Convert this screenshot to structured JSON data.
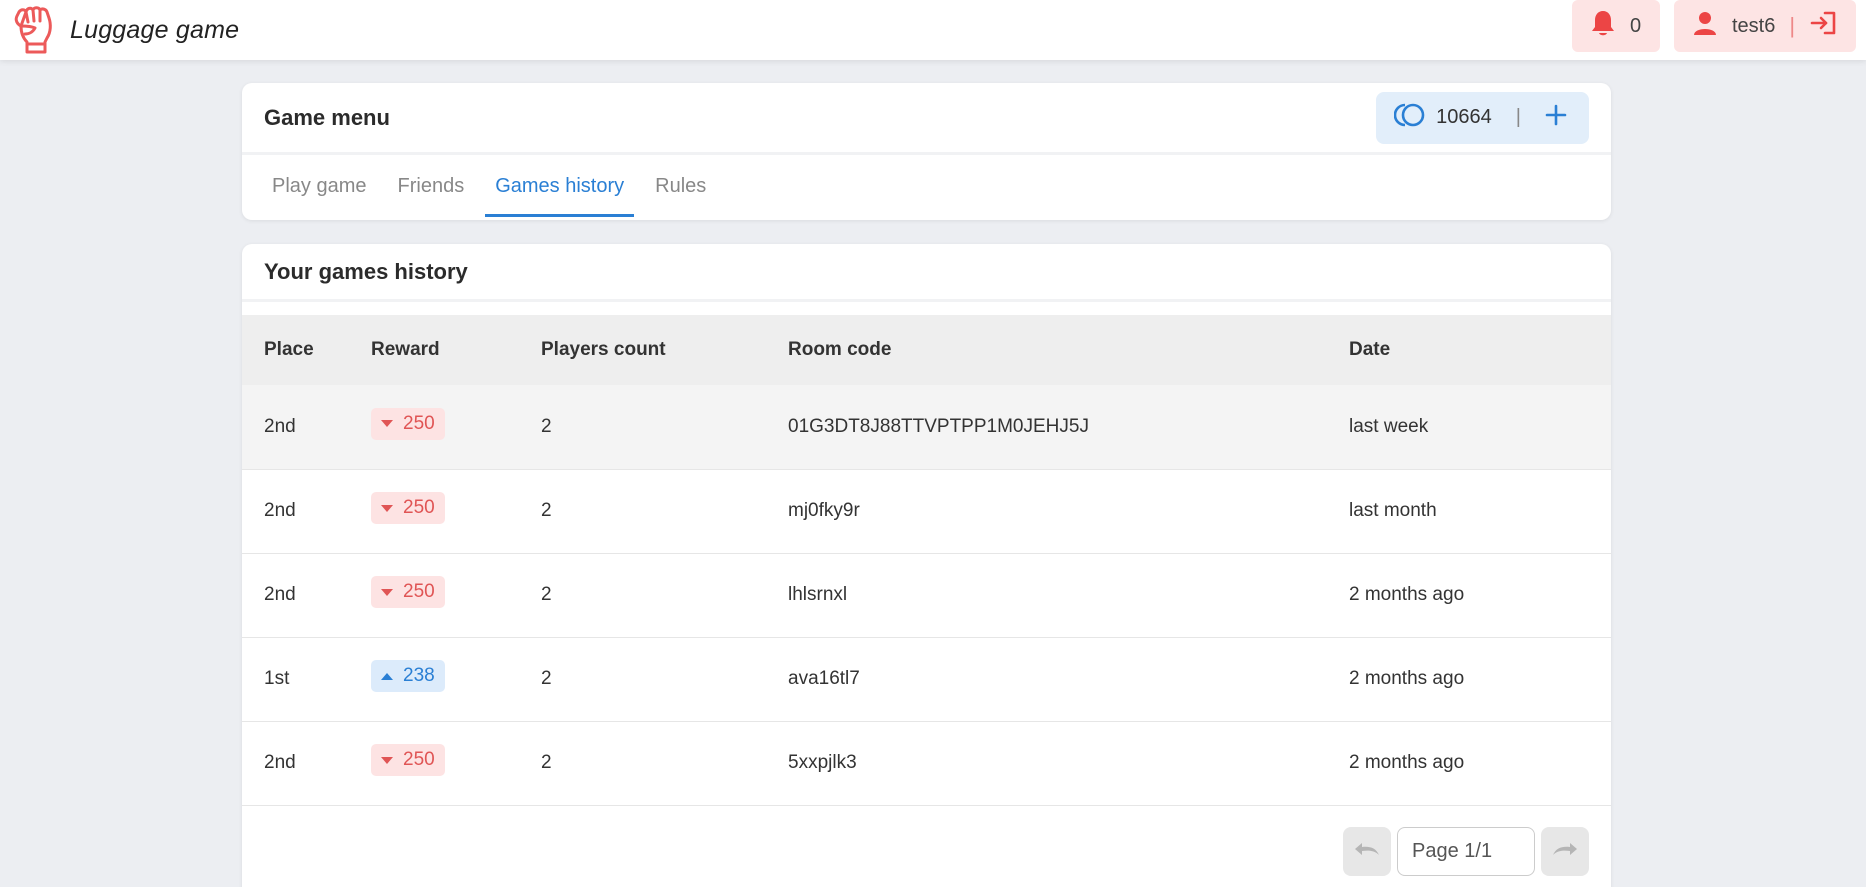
{
  "app": {
    "title": "Luggage game",
    "accent": "#2a7fd4",
    "danger": "#e05555"
  },
  "navbar": {
    "notifications_count": "0",
    "username": "test6",
    "icons": [
      "fist-logo-icon",
      "bell-icon",
      "user-icon",
      "logout-icon"
    ]
  },
  "menu": {
    "title": "Game menu",
    "balance": "10664",
    "tabs": [
      {
        "label": "Play game",
        "active": false
      },
      {
        "label": "Friends",
        "active": false
      },
      {
        "label": "Games history",
        "active": true
      },
      {
        "label": "Rules",
        "active": false
      }
    ]
  },
  "history": {
    "title": "Your games history",
    "columns": [
      "Place",
      "Reward",
      "Players count",
      "Room code",
      "Date"
    ],
    "rows": [
      {
        "place": "2nd",
        "reward": "250",
        "direction": "down",
        "players": "2",
        "room": "01G3DT8J88TTVPTPP1M0JEHJ5J",
        "date": "last week"
      },
      {
        "place": "2nd",
        "reward": "250",
        "direction": "down",
        "players": "2",
        "room": "mj0fky9r",
        "date": "last month"
      },
      {
        "place": "2nd",
        "reward": "250",
        "direction": "down",
        "players": "2",
        "room": "lhlsrnxl",
        "date": "2 months ago"
      },
      {
        "place": "1st",
        "reward": "238",
        "direction": "up",
        "players": "2",
        "room": "ava16tl7",
        "date": "2 months ago"
      },
      {
        "place": "2nd",
        "reward": "250",
        "direction": "down",
        "players": "2",
        "room": "5xxpjlk3",
        "date": "2 months ago"
      }
    ],
    "pager": {
      "value": "Page 1/1"
    }
  }
}
